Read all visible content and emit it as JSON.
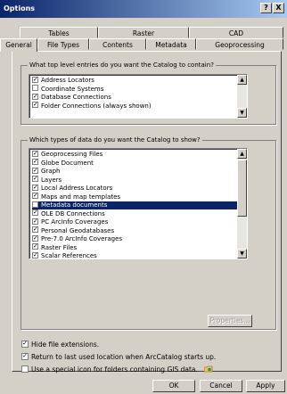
{
  "window": {
    "title": "Options",
    "help_label": "?",
    "close_label": "X"
  },
  "tabs": {
    "row1": [
      "Tables",
      "Raster",
      "CAD"
    ],
    "row2": [
      "General",
      "File Types",
      "Contents",
      "Metadata",
      "Geoprocessing"
    ],
    "active": "General"
  },
  "top_group": {
    "label": "What top level entries do you want the Catalog to contain?",
    "items": [
      {
        "label": "Address Locators",
        "checked": true
      },
      {
        "label": "Coordinate Systems",
        "checked": false
      },
      {
        "label": "Database Connections",
        "checked": true
      },
      {
        "label": "Folder Connections (always shown)",
        "checked": true
      }
    ]
  },
  "types_group": {
    "label": "Which types of data do you want the Catalog to show?",
    "items": [
      {
        "label": "Geoprocessing Files",
        "checked": true
      },
      {
        "label": "Globe Document",
        "checked": true
      },
      {
        "label": "Graph",
        "checked": true
      },
      {
        "label": "Layers",
        "checked": true
      },
      {
        "label": "Local Address Locators",
        "checked": true
      },
      {
        "label": "Maps and map templates",
        "checked": true
      },
      {
        "label": "Metadata documents",
        "checked": false,
        "selected": true
      },
      {
        "label": "OLE DB Connections",
        "checked": true
      },
      {
        "label": "PC ArcInfo Coverages",
        "checked": true
      },
      {
        "label": "Personal Geodatabases",
        "checked": true
      },
      {
        "label": "Pre-7.0 ArcInfo Coverages",
        "checked": true
      },
      {
        "label": "Raster Files",
        "checked": true
      },
      {
        "label": "Scalar References",
        "checked": true
      }
    ],
    "properties_label": "Properties..."
  },
  "options": [
    {
      "label": "Hide file extensions.",
      "checked": true
    },
    {
      "label": "Return to last used location when ArcCatalog starts up.",
      "checked": true
    },
    {
      "label": "Use a special icon for folders containing GIS data.",
      "checked": false
    }
  ],
  "buttons": {
    "ok": "OK",
    "cancel": "Cancel",
    "apply": "Apply"
  },
  "colors": {
    "selection": "#0a246a",
    "titlebar": "#0a246a",
    "face": "#d4d0c8"
  }
}
